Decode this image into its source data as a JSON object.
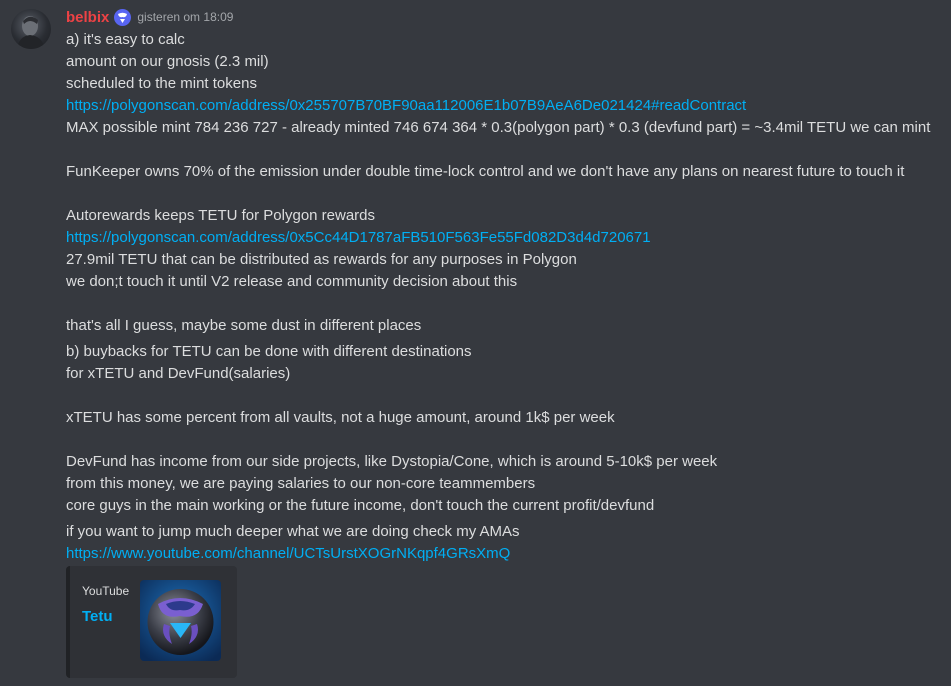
{
  "message": {
    "author": "belbix",
    "timestamp": "gisteren om 18:09",
    "lines": [
      "a) it's easy to calc",
      "amount on our gnosis (2.3 mil)",
      "scheduled to the mint tokens",
      "https://polygonscan.com/address/0x255707B70BF90aa112006E1b07B9AeA6De021424#readContract",
      "MAX possible mint 784 236 727 - already minted 746 674 364 * 0.3(polygon part) * 0.3 (devfund part) = ~3.4mil TETU we can mint",
      "FunKeeper owns 70% of the emission under double time-lock control and we don't have any plans on nearest future to touch it",
      "Autorewards keeps TETU for Polygon rewards",
      "https://polygonscan.com/address/0x5Cc44D1787aFB510F563Fe55Fd082D3d4d720671",
      "27.9mil TETU that can be distributed as rewards for any purposes in Polygon",
      "we don;t touch it until V2 release and community decision about this",
      "that's all I guess, maybe some dust in different places",
      "b) buybacks for TETU can be done with different destinations",
      "for xTETU and DevFund(salaries)",
      "xTETU has some percent from all vaults, not a huge amount, around 1k$ per week",
      "DevFund has income from our side projects, like Dystopia/Cone, which is around 5-10k$ per week",
      "from this money, we are paying salaries to our non-core teammembers",
      "core guys in the main working or the future income, don't touch the current profit/devfund",
      "if you want to jump much deeper what we are doing check my AMAs",
      "https://www.youtube.com/channel/UCTsUrstXOGrNKqpf4GRsXmQ"
    ]
  },
  "embed": {
    "provider": "YouTube",
    "title": "Tetu"
  },
  "icons": {
    "avatar": "user-avatar",
    "badge": "server-badge-icon",
    "thumbnail": "tetu-logo-thumbnail"
  },
  "colors": {
    "background": "#36393f",
    "username": "#ed4245",
    "link": "#00aff4",
    "text": "#dcddde",
    "timestamp": "#a3a6aa",
    "embed_bg": "#2f3136"
  }
}
